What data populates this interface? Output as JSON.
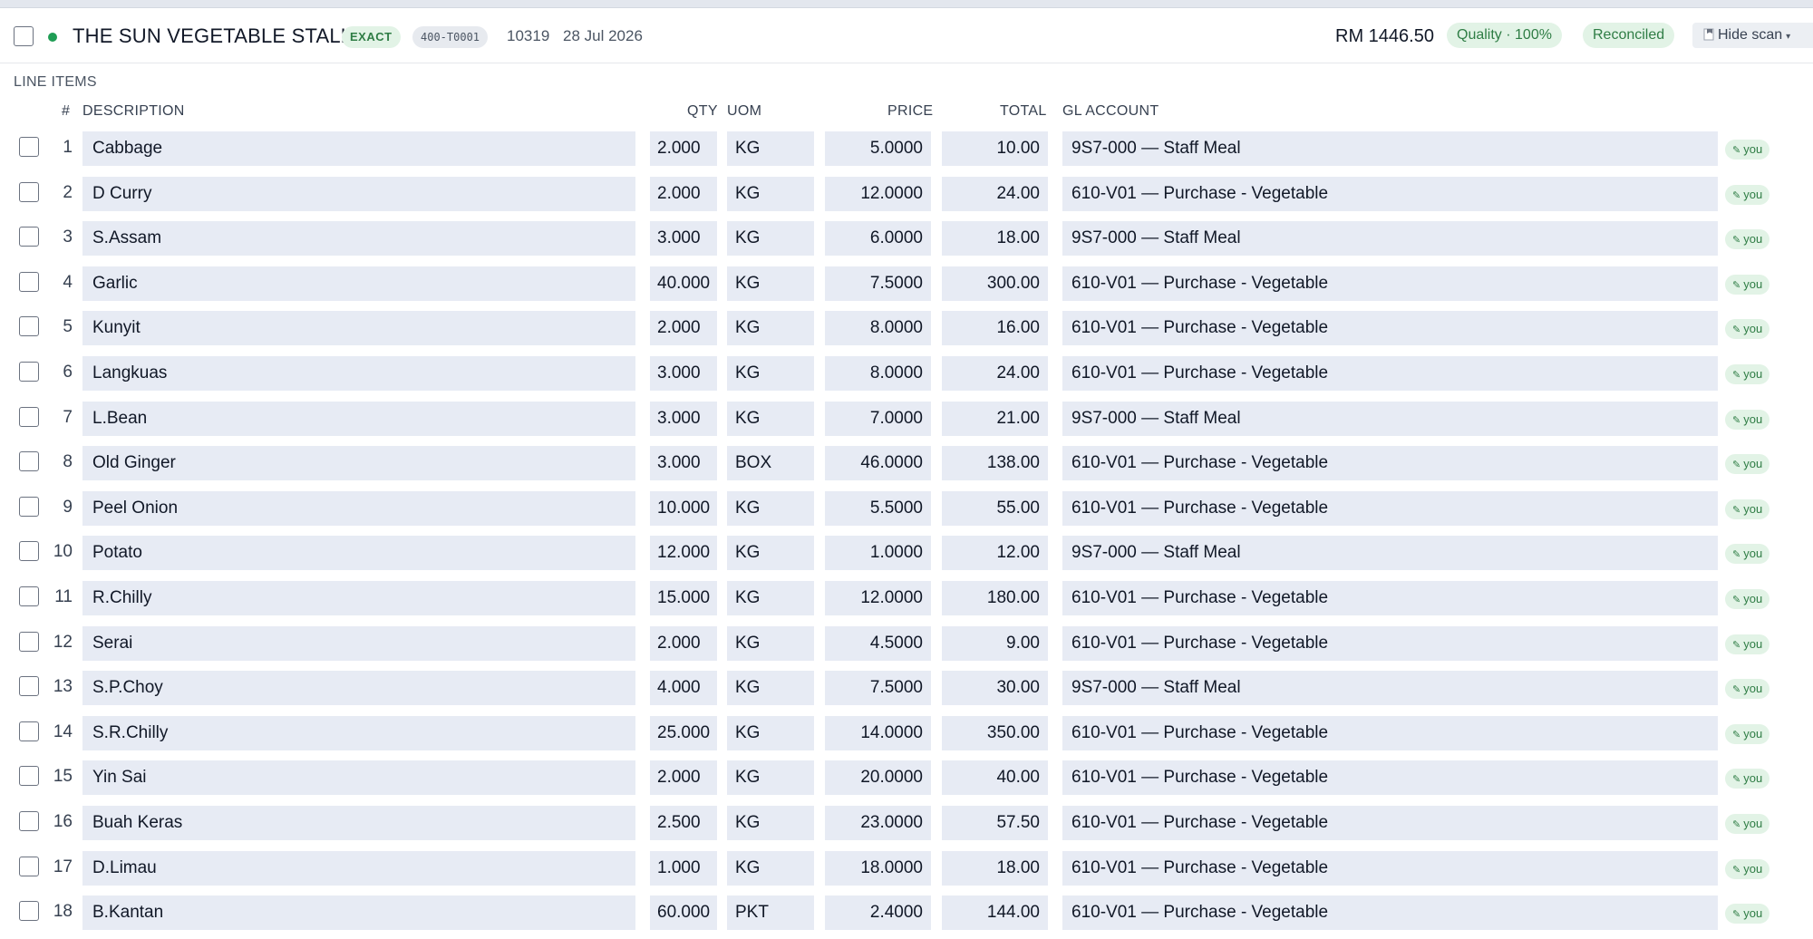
{
  "header": {
    "vendor": "THE SUN VEGETABLE STALL",
    "match_badge": "EXACT",
    "code_badge": "400-T0001",
    "doc_number": "10319",
    "date": "28 Jul 2026",
    "amount": "RM 1446.50",
    "quality_badge": "Quality · 100%",
    "status_badge": "Reconciled",
    "hide_scan_label": "Hide scan",
    "status_dot_color": "#1f9d55"
  },
  "section": {
    "title": "LINE ITEMS"
  },
  "columns": {
    "num": "#",
    "description": "DESCRIPTION",
    "qty": "QTY",
    "uom": "UOM",
    "price": "PRICE",
    "total": "TOTAL",
    "gl_account": "GL ACCOUNT"
  },
  "rows": [
    {
      "n": "1",
      "desc": "Cabbage",
      "qty": "2.000",
      "uom": "KG",
      "price": "5.0000",
      "total": "10.00",
      "gl": "9S7-000 — Staff Meal",
      "tag": "you"
    },
    {
      "n": "2",
      "desc": "D Curry",
      "qty": "2.000",
      "uom": "KG",
      "price": "12.0000",
      "total": "24.00",
      "gl": "610-V01 — Purchase - Vegetable",
      "tag": "you"
    },
    {
      "n": "3",
      "desc": "S.Assam",
      "qty": "3.000",
      "uom": "KG",
      "price": "6.0000",
      "total": "18.00",
      "gl": "9S7-000 — Staff Meal",
      "tag": "you"
    },
    {
      "n": "4",
      "desc": "Garlic",
      "qty": "40.000",
      "uom": "KG",
      "price": "7.5000",
      "total": "300.00",
      "gl": "610-V01 — Purchase - Vegetable",
      "tag": "you"
    },
    {
      "n": "5",
      "desc": "Kunyit",
      "qty": "2.000",
      "uom": "KG",
      "price": "8.0000",
      "total": "16.00",
      "gl": "610-V01 — Purchase - Vegetable",
      "tag": "you"
    },
    {
      "n": "6",
      "desc": "Langkuas",
      "qty": "3.000",
      "uom": "KG",
      "price": "8.0000",
      "total": "24.00",
      "gl": "610-V01 — Purchase - Vegetable",
      "tag": "you"
    },
    {
      "n": "7",
      "desc": "L.Bean",
      "qty": "3.000",
      "uom": "KG",
      "price": "7.0000",
      "total": "21.00",
      "gl": "9S7-000 — Staff Meal",
      "tag": "you"
    },
    {
      "n": "8",
      "desc": "Old Ginger",
      "qty": "3.000",
      "uom": "BOX",
      "price": "46.0000",
      "total": "138.00",
      "gl": "610-V01 — Purchase - Vegetable",
      "tag": "you"
    },
    {
      "n": "9",
      "desc": "Peel Onion",
      "qty": "10.000",
      "uom": "KG",
      "price": "5.5000",
      "total": "55.00",
      "gl": "610-V01 — Purchase - Vegetable",
      "tag": "you"
    },
    {
      "n": "10",
      "desc": "Potato",
      "qty": "12.000",
      "uom": "KG",
      "price": "1.0000",
      "total": "12.00",
      "gl": "9S7-000 — Staff Meal",
      "tag": "you"
    },
    {
      "n": "11",
      "desc": "R.Chilly",
      "qty": "15.000",
      "uom": "KG",
      "price": "12.0000",
      "total": "180.00",
      "gl": "610-V01 — Purchase - Vegetable",
      "tag": "you"
    },
    {
      "n": "12",
      "desc": "Serai",
      "qty": "2.000",
      "uom": "KG",
      "price": "4.5000",
      "total": "9.00",
      "gl": "610-V01 — Purchase - Vegetable",
      "tag": "you"
    },
    {
      "n": "13",
      "desc": "S.P.Choy",
      "qty": "4.000",
      "uom": "KG",
      "price": "7.5000",
      "total": "30.00",
      "gl": "9S7-000 — Staff Meal",
      "tag": "you"
    },
    {
      "n": "14",
      "desc": "S.R.Chilly",
      "qty": "25.000",
      "uom": "KG",
      "price": "14.0000",
      "total": "350.00",
      "gl": "610-V01 — Purchase - Vegetable",
      "tag": "you"
    },
    {
      "n": "15",
      "desc": "Yin Sai",
      "qty": "2.000",
      "uom": "KG",
      "price": "20.0000",
      "total": "40.00",
      "gl": "610-V01 — Purchase - Vegetable",
      "tag": "you"
    },
    {
      "n": "16",
      "desc": "Buah Keras",
      "qty": "2.500",
      "uom": "KG",
      "price": "23.0000",
      "total": "57.50",
      "gl": "610-V01 — Purchase - Vegetable",
      "tag": "you"
    },
    {
      "n": "17",
      "desc": "D.Limau",
      "qty": "1.000",
      "uom": "KG",
      "price": "18.0000",
      "total": "18.00",
      "gl": "610-V01 — Purchase - Vegetable",
      "tag": "you"
    },
    {
      "n": "18",
      "desc": "B.Kantan",
      "qty": "60.000",
      "uom": "PKT",
      "price": "2.4000",
      "total": "144.00",
      "gl": "610-V01 — Purchase - Vegetable",
      "tag": "you"
    }
  ]
}
